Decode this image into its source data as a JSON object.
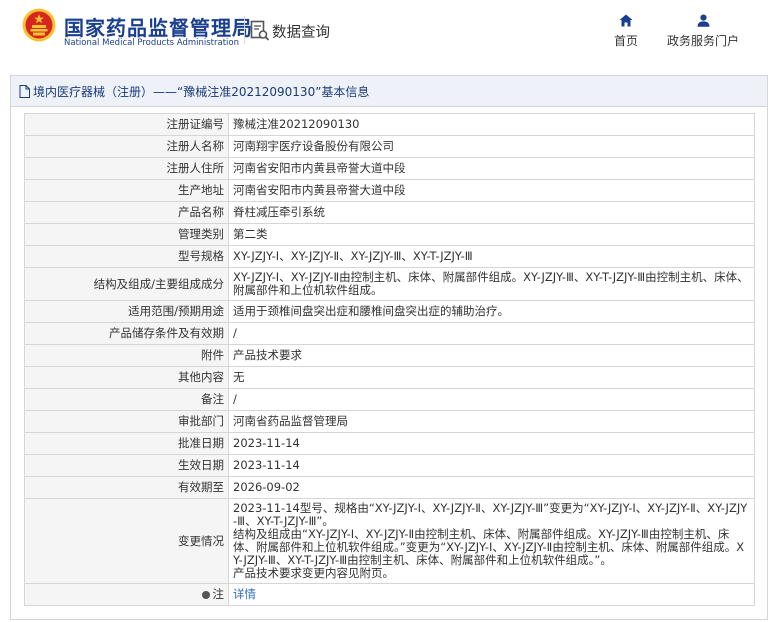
{
  "header": {
    "org_cn": "国家药品监督管理局",
    "org_en": "National Medical Products Administration",
    "query_label": "数据查询",
    "nav_home": "首页",
    "nav_portal": "政务服务门户"
  },
  "panel": {
    "title": "境内医疗器械（注册）——“豫械注准20212090130”基本信息"
  },
  "rows": [
    {
      "label": "注册证编号",
      "value": "豫械注准20212090130"
    },
    {
      "label": "注册人名称",
      "value": "河南翔宇医疗设备股份有限公司"
    },
    {
      "label": "注册人住所",
      "value": "河南省安阳市内黄县帝誉大道中段"
    },
    {
      "label": "生产地址",
      "value": "河南省安阳市内黄县帝誉大道中段"
    },
    {
      "label": "产品名称",
      "value": "脊柱减压牵引系统"
    },
    {
      "label": "管理类别",
      "value": "第二类"
    },
    {
      "label": "型号规格",
      "value": "XY-JZJY-Ⅰ、XY-JZJY-Ⅱ、XY-JZJY-Ⅲ、XY-T-JZJY-Ⅲ"
    },
    {
      "label": "结构及组成/主要组成成分",
      "value": "XY-JZJY-Ⅰ、XY-JZJY-Ⅱ由控制主机、床体、附属部件组成。XY-JZJY-Ⅲ、XY-T-JZJY-Ⅲ由控制主机、床体、附属部件和上位机软件组成。"
    },
    {
      "label": "适用范围/预期用途",
      "value": "适用于颈椎间盘突出症和腰椎间盘突出症的辅助治疗。"
    },
    {
      "label": "产品储存条件及有效期",
      "value": "/"
    },
    {
      "label": "附件",
      "value": "产品技术要求"
    },
    {
      "label": "其他内容",
      "value": "无"
    },
    {
      "label": "备注",
      "value": "/"
    },
    {
      "label": "审批部门",
      "value": "河南省药品监督管理局"
    },
    {
      "label": "批准日期",
      "value": "2023-11-14"
    },
    {
      "label": "生效日期",
      "value": "2023-11-14"
    },
    {
      "label": "有效期至",
      "value": "2026-09-02"
    }
  ],
  "change": {
    "label": "变更情况",
    "lines": [
      "2023-11-14型号、规格由“XY-JZJY-Ⅰ、XY-JZJY-Ⅱ、XY-JZJY-Ⅲ”变更为“XY-JZJY-Ⅰ、XY-JZJY-Ⅱ、XY-JZJY-Ⅲ、XY-T-JZJY-Ⅲ”。",
      "结构及组成由“XY-JZJY-Ⅰ、XY-JZJY-Ⅱ由控制主机、床体、附属部件组成。XY-JZJY-Ⅲ由控制主机、床体、附属部件和上位机软件组成。”变更为“XY-JZJY-Ⅰ、XY-JZJY-Ⅱ由控制主机、床体、附属部件组成。XY-JZJY-Ⅲ、XY-T-JZJY-Ⅲ由控制主机、床体、附属部件和上位机软件组成。”。",
      "产品技术要求变更内容见附页。"
    ]
  },
  "note": {
    "label": "注",
    "link": "详情"
  },
  "colors": {
    "brand_blue": "#1b3f8f",
    "emblem_red": "#d7261f",
    "emblem_gold": "#f6c431",
    "link_blue": "#2b6cc4"
  },
  "icons": [
    "national-emblem-icon",
    "search-doc-icon",
    "home-icon",
    "user-icon",
    "doc-icon",
    "pin-icon"
  ]
}
